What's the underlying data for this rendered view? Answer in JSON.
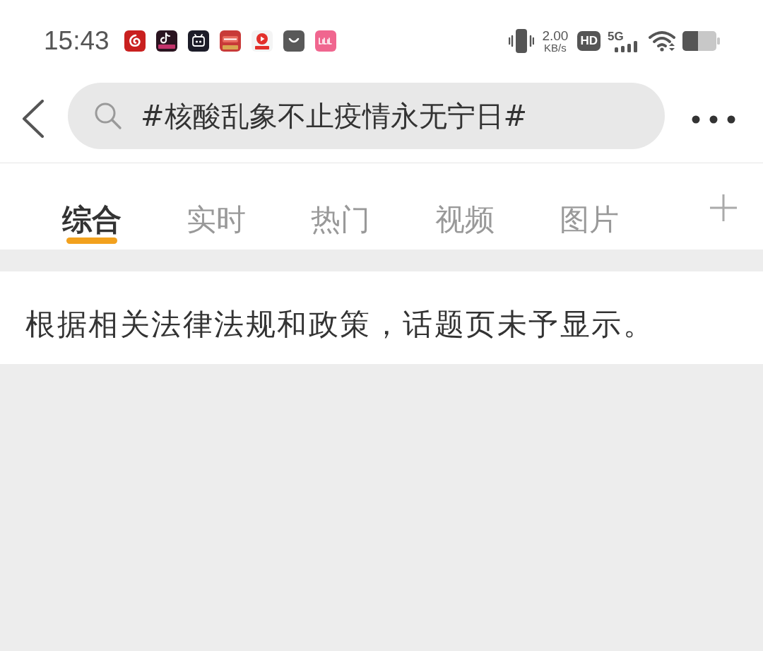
{
  "status_bar": {
    "time": "15:43",
    "network_speed": "2.00",
    "speed_unit": "KB/s",
    "hd_badge": "HD",
    "network_type": "5G"
  },
  "header": {
    "search": {
      "value": "#核酸乱象不止疫情永无宁日#"
    }
  },
  "tabs": [
    {
      "label": "综合",
      "selected": true
    },
    {
      "label": "实时",
      "selected": false
    },
    {
      "label": "热门",
      "selected": false
    },
    {
      "label": "视频",
      "selected": false
    },
    {
      "label": "图片",
      "selected": false
    }
  ],
  "notice": "根据相关法律法规和政策，话题页未予显示。"
}
